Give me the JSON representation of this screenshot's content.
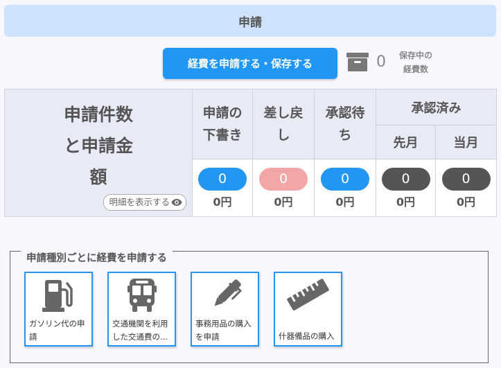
{
  "header": {
    "title": "申請"
  },
  "toolbar": {
    "submit_label": "経費を申請する・保存する",
    "saved_count": "0",
    "saved_label_line1": "保存中の",
    "saved_label_line2": "経費数"
  },
  "summary": {
    "row_header_line1": "申請件数",
    "row_header_line2": "と申請金",
    "row_header_line3": "額",
    "detail_label": "明細を表示する",
    "columns": [
      {
        "label_line1": "申請の",
        "label_line2": "下書き",
        "count": "0",
        "amount": "0円",
        "color": "#2196f3"
      },
      {
        "label_line1": "差し戻",
        "label_line2": "し",
        "count": "0",
        "amount": "0円",
        "color": "#f4a6a6"
      },
      {
        "label_line1": "承認待",
        "label_line2": "ち",
        "count": "0",
        "amount": "0円",
        "color": "#2196f3"
      }
    ],
    "approved": {
      "label": "承認済み",
      "last_month": {
        "label": "先月",
        "count": "0",
        "amount": "0円",
        "color": "#555555"
      },
      "this_month": {
        "label": "当月",
        "count": "0",
        "amount": "0円",
        "color": "#555555"
      }
    }
  },
  "categories": {
    "legend": "申請種別ごとに経費を申請する",
    "cards": [
      {
        "label": "ガソリン代の申請",
        "icon": "gas-pump-icon"
      },
      {
        "label": "交通機関を利用した交通費の...",
        "icon": "bus-icon"
      },
      {
        "label": "事務用品の購入を申請",
        "icon": "pen-icon"
      },
      {
        "label": "什器備品の購入",
        "icon": "ruler-icon"
      }
    ]
  }
}
